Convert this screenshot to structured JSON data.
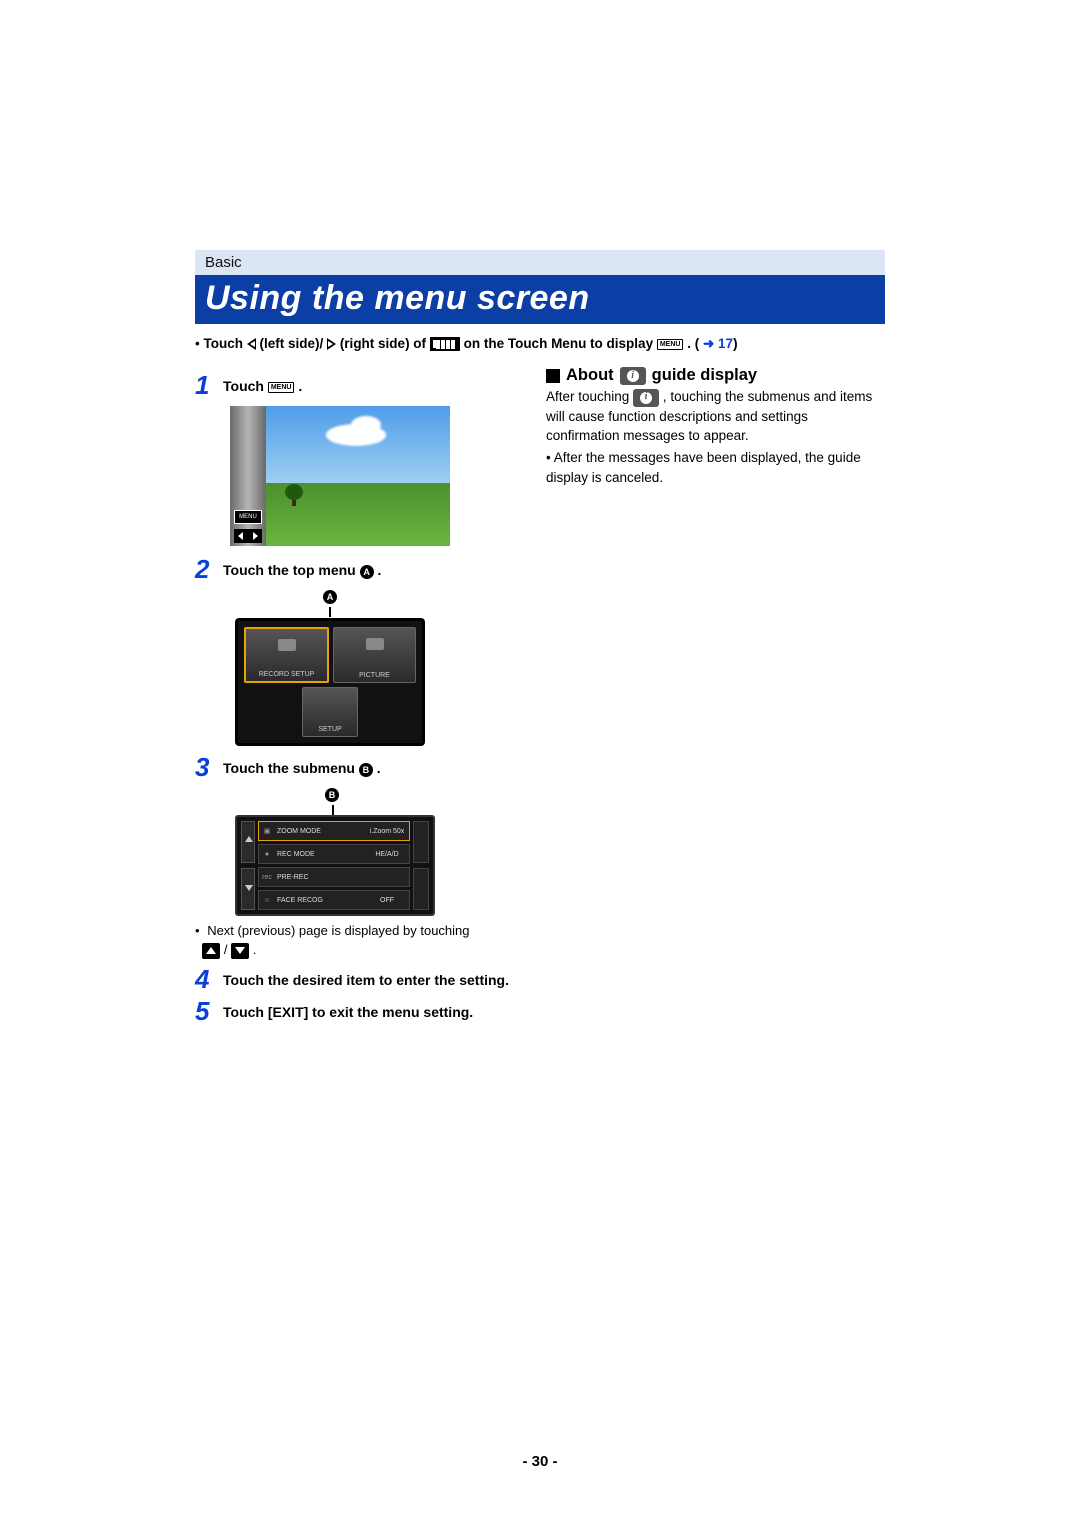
{
  "section_label": "Basic",
  "title": "Using the menu screen",
  "intro": {
    "prefix": "Touch ",
    "left_side": " (left side)/",
    "right_side": " (right side) of ",
    "mid": " on the Touch Menu to display ",
    "menu_label": "MENU",
    "suffix": " . (",
    "link": "➜ 17",
    "close": ")"
  },
  "steps": [
    {
      "num": "1",
      "text_before": "Touch ",
      "chip": "MENU",
      "text_after": " ."
    },
    {
      "num": "2",
      "text_before": "Touch the top menu ",
      "label": "A",
      "text_after": "."
    },
    {
      "num": "3",
      "text_before": "Touch the submenu ",
      "label": "B",
      "text_after": "."
    },
    {
      "num": "4",
      "text": "Touch the desired item to enter the setting."
    },
    {
      "num": "5",
      "text": "Touch [EXIT] to exit the menu setting."
    }
  ],
  "illus1_menu": "MENU",
  "illus2": {
    "label": "A",
    "cards": [
      "RECORD SETUP",
      "PICTURE",
      "SETUP"
    ]
  },
  "illus3": {
    "label": "B",
    "items": [
      {
        "icon": "▣",
        "name": "ZOOM MODE",
        "value": "i.Zoom 50x",
        "selected": true
      },
      {
        "icon": "●",
        "name": "REC MODE",
        "value": "HE/A/D"
      },
      {
        "icon": "rec",
        "name": "PRE-REC",
        "value": ""
      },
      {
        "icon": "☺",
        "name": "FACE RECOG",
        "value": "OFF"
      }
    ]
  },
  "note_page": "Next (previous) page is displayed by touching",
  "note_slash": "/",
  "note_period": " .",
  "right": {
    "about_before": "About ",
    "about_after": " guide display",
    "p1a": "After touching ",
    "p1b": " , touching the submenus and items will cause function descriptions and settings confirmation messages to appear.",
    "p2": "After the messages have been displayed, the guide display is canceled."
  },
  "page_number": "- 30 -"
}
